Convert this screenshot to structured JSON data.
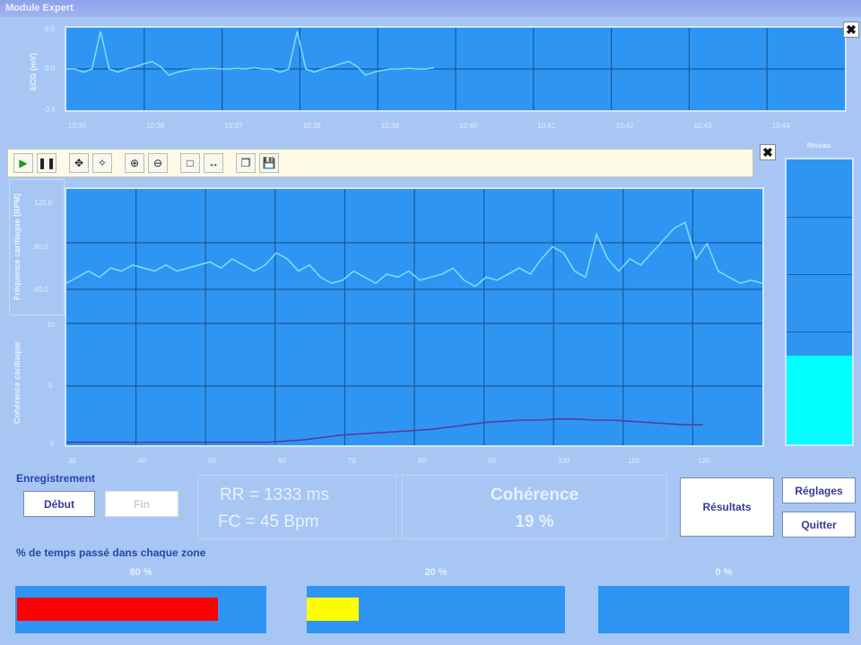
{
  "window": {
    "title": "Module Expert"
  },
  "ecg": {
    "ylabel": "ECG (mV)",
    "yticks": [
      "0.5",
      "0.0",
      "-0.5"
    ],
    "xticks": [
      "10:35",
      "10:36",
      "10:37",
      "10:38",
      "10:39",
      "10:40",
      "10:41",
      "10:42",
      "10:43",
      "10:44"
    ],
    "values": [
      0,
      0,
      -0.05,
      0,
      0.6,
      0,
      -0.05,
      0,
      0.03,
      0.08,
      0.12,
      0.04,
      -0.1,
      -0.05,
      -0.02,
      0,
      0,
      0.01,
      0,
      0,
      0.01,
      0,
      0.02,
      0,
      0,
      -0.05,
      0,
      0.6,
      0,
      -0.05,
      0,
      0.03,
      0.08,
      0.12,
      0.04,
      -0.1,
      -0.05,
      -0.02,
      0,
      0,
      0.01,
      0,
      0,
      0.02
    ]
  },
  "toolbar": {
    "items": [
      {
        "name": "play",
        "glyph": "▶"
      },
      {
        "name": "pause",
        "glyph": "❚❚"
      },
      {
        "name": "pan",
        "glyph": "✥"
      },
      {
        "name": "select",
        "glyph": "✧"
      },
      {
        "name": "zoom-in",
        "glyph": "⊕"
      },
      {
        "name": "zoom-out",
        "glyph": "⊖"
      },
      {
        "name": "box",
        "glyph": "□"
      },
      {
        "name": "fit",
        "glyph": "↔"
      },
      {
        "name": "copy",
        "glyph": "❐"
      },
      {
        "name": "save",
        "glyph": "💾"
      }
    ]
  },
  "hr": {
    "ylabel": "Fréquence cardiaque (BPM)",
    "yticks": [
      "120.0",
      "90.0",
      "60.0"
    ],
    "values": [
      62,
      64,
      66,
      64,
      67,
      66,
      68,
      67,
      66,
      68,
      66,
      67,
      68,
      69,
      67,
      70,
      68,
      66,
      68,
      72,
      70,
      66,
      68,
      64,
      62,
      63,
      66,
      64,
      62,
      65,
      64,
      66,
      63,
      64,
      65,
      67,
      63,
      61,
      64,
      63,
      65,
      67,
      65,
      70,
      74,
      72,
      66,
      64,
      78,
      70,
      66,
      70,
      68,
      72,
      76,
      80,
      82,
      70,
      75,
      66,
      64,
      62,
      63,
      62
    ]
  },
  "coh": {
    "ylabel": "Cohérence cardiaque",
    "yticks": [
      "10",
      "5",
      "0"
    ],
    "values": [
      0.1,
      0.1,
      0.1,
      0.1,
      0.1,
      0.1,
      0.1,
      0.1,
      0.1,
      0.1,
      0.1,
      0.1,
      0.2,
      0.3,
      0.5,
      0.7,
      0.8,
      0.9,
      1.0,
      1.1,
      1.2,
      1.4,
      1.6,
      1.8,
      1.9,
      2.0,
      2.0,
      2.1,
      2.1,
      2.0,
      2.0,
      1.9,
      1.8,
      1.7,
      1.6,
      1.6
    ],
    "xticks": [
      "30",
      "40",
      "50",
      "60",
      "70",
      "80",
      "90",
      "100",
      "110",
      "120"
    ]
  },
  "gauge": {
    "label": "Niveau",
    "level": 0.31,
    "color": "#00ffff"
  },
  "recording": {
    "label": "Enregistrement",
    "start": "Début",
    "stop": "Fin"
  },
  "readout": {
    "rr": "RR = 1333 ms",
    "fc": "FC = 45 Bpm"
  },
  "coherence": {
    "label": "Cohérence",
    "value": "19 %"
  },
  "buttons": {
    "results": "Résultats",
    "settings": "Réglages",
    "quit": "Quitter"
  },
  "zones": {
    "title": "% de temps passé dans chaque zone",
    "items": [
      {
        "pct": "80 %",
        "fill": 0.8,
        "color": "#ff0000"
      },
      {
        "pct": "20 %",
        "fill": 0.2,
        "color": "#ffff00"
      },
      {
        "pct": "0 %",
        "fill": 0,
        "color": "#00ff00"
      }
    ]
  },
  "close_glyph": "✖"
}
